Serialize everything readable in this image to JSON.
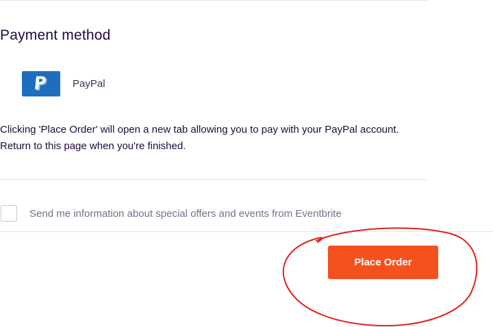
{
  "payment": {
    "section_title": "Payment method",
    "option_label": "PayPal",
    "option_icon": "paypal-icon",
    "note_line1": "Clicking 'Place Order' will open a new tab allowing you to pay with your PayPal account.",
    "note_line2": "Return to this page when you're finished."
  },
  "optin": {
    "label": "Send me information about special offers and events from Eventbrite",
    "checked": false
  },
  "footer": {
    "place_order_label": "Place Order"
  },
  "colors": {
    "accent": "#f4511e",
    "paypal_blue": "#1d6fbd",
    "annotation_red": "#e0201b",
    "text": "#1e0a3c",
    "muted_text": "#6f7287"
  }
}
